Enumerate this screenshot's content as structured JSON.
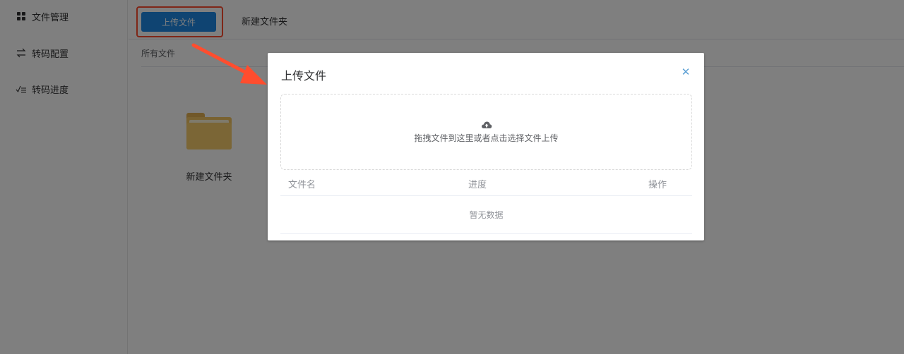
{
  "sidebar": {
    "items": [
      {
        "label": "文件管理",
        "icon": "grid-icon"
      },
      {
        "label": "转码配置",
        "icon": "swap-arrows-icon"
      },
      {
        "label": "转码进度",
        "icon": "check-list-icon"
      }
    ]
  },
  "toolbar": {
    "upload_label": "上传文件",
    "new_folder_label": "新建文件夹"
  },
  "breadcrumb": "所有文件",
  "files": [
    {
      "name": "新建文件夹",
      "type": "folder"
    }
  ],
  "dialog": {
    "title": "上传文件",
    "close_icon": "close-icon",
    "dropzone_icon": "cloud-upload-icon",
    "dropzone_text": "拖拽文件到这里或者点击选择文件上传",
    "table": {
      "columns": [
        "文件名",
        "进度",
        "操作"
      ],
      "empty_text": "暂无数据"
    }
  },
  "colors": {
    "primary": "#1e88e5",
    "highlight": "#ff4d2e",
    "folder": "#f2c462",
    "overlay": "rgba(0,0,0,0.5)"
  }
}
